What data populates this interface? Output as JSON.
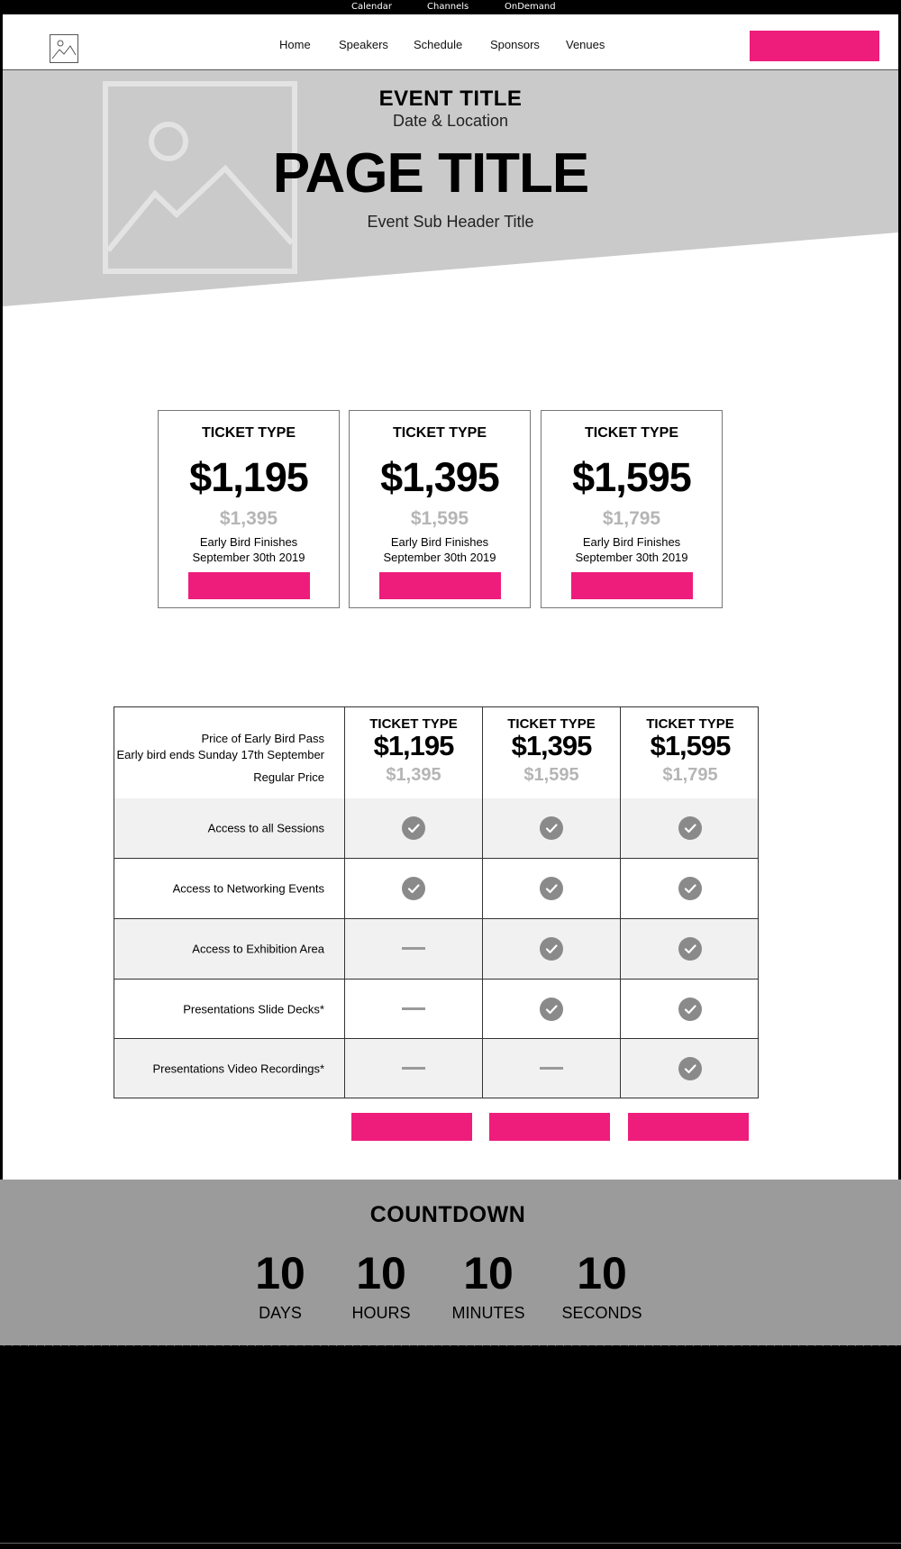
{
  "topbar": {
    "links": [
      {
        "label": "Calendar"
      },
      {
        "label": "Channels"
      },
      {
        "label": "OnDemand"
      }
    ]
  },
  "header": {
    "nav": [
      {
        "label": "Home"
      },
      {
        "label": "Speakers"
      },
      {
        "label": "Schedule"
      },
      {
        "label": "Sponsors"
      },
      {
        "label": "Venues"
      }
    ],
    "cta_color": "#ee1d7b"
  },
  "hero": {
    "event_title": "EVENT TITLE",
    "date_location": "Date & Location",
    "page_title": "PAGE TITLE",
    "sub_header": "Event Sub Header Title",
    "image_icon": "image-placeholder-icon"
  },
  "tickets": [
    {
      "type": "TICKET TYPE",
      "price": "$1,195",
      "regular": "$1,395",
      "early_line1": "Early Bird Finishes",
      "early_line2": "September 30th 2019"
    },
    {
      "type": "TICKET TYPE",
      "price": "$1,395",
      "regular": "$1,595",
      "early_line1": "Early Bird Finishes",
      "early_line2": "September 30th 2019"
    },
    {
      "type": "TICKET TYPE",
      "price": "$1,595",
      "regular": "$1,795",
      "early_line1": "Early Bird Finishes",
      "early_line2": "September 30th 2019"
    }
  ],
  "comparison": {
    "header": {
      "label_line1": "Price of Early Bird Pass",
      "label_line2": "Early bird ends Sunday 17th September",
      "label_line3": "Regular Price"
    },
    "columns": [
      {
        "type": "TICKET TYPE",
        "price": "$1,195",
        "regular": "$1,395"
      },
      {
        "type": "TICKET TYPE",
        "price": "$1,395",
        "regular": "$1,595"
      },
      {
        "type": "TICKET TYPE",
        "price": "$1,595",
        "regular": "$1,795"
      }
    ],
    "rows": [
      {
        "feature": "Access to all Sessions",
        "included": [
          true,
          true,
          true
        ]
      },
      {
        "feature": "Access to Networking Events",
        "included": [
          true,
          true,
          true
        ]
      },
      {
        "feature": "Access to Exhibition Area",
        "included": [
          false,
          true,
          true
        ]
      },
      {
        "feature": "Presentations Slide Decks*",
        "included": [
          false,
          true,
          true
        ]
      },
      {
        "feature": "Presentations Video Recordings*",
        "included": [
          false,
          false,
          true
        ]
      }
    ]
  },
  "countdown": {
    "title": "COUNTDOWN",
    "units": [
      {
        "value": "10",
        "label": "DAYS"
      },
      {
        "value": "10",
        "label": "HOURS"
      },
      {
        "value": "10",
        "label": "MINUTES"
      },
      {
        "value": "10",
        "label": "SECONDS"
      }
    ]
  }
}
